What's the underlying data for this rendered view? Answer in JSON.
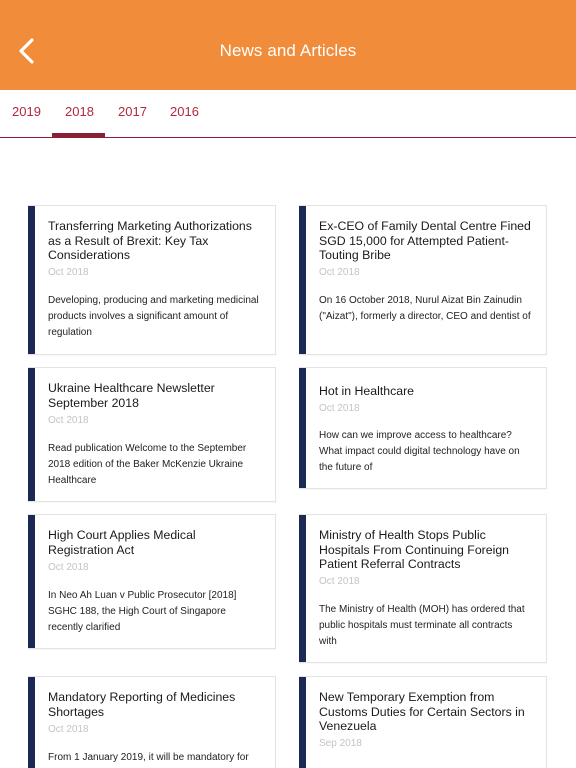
{
  "header": {
    "title": "News and Articles",
    "back_icon": "chevron-left-icon"
  },
  "tabs": [
    {
      "label": "2019"
    },
    {
      "label": "2018",
      "active": true
    },
    {
      "label": "2017"
    },
    {
      "label": "2016"
    }
  ],
  "colors": {
    "header_bg": "#f08c3a",
    "tab_text": "#b3283e",
    "tab_active": "#8a2036",
    "card_accent": "#1b2a55"
  },
  "articles": [
    {
      "title": "Transferring Marketing Authorizations as a Result of Brexit: Key Tax Considerations",
      "date": "Oct 2018",
      "excerpt": "Developing, producing and marketing medicinal products involves a significant amount of regulation"
    },
    {
      "title": "Ex-CEO of Family Dental Centre Fined SGD 15,000 for Attempted Patient-Touting Bribe",
      "date": "Oct 2018",
      "excerpt": "On 16 October 2018, Nurul Aizat Bin Zainudin (\"Aizat\"), formerly a director, CEO and dentist of"
    },
    {
      "title": "Ukraine Healthcare Newsletter September 2018",
      "date": "Oct 2018",
      "excerpt": "Read publication Welcome to the September 2018 edition of the Baker McKenzie Ukraine Healthcare"
    },
    {
      "title": "Hot in Healthcare",
      "date": "Oct 2018",
      "excerpt": "How can we improve access to healthcare? What impact could digital technology have on the future of"
    },
    {
      "title": "High Court Applies Medical Registration Act",
      "date": "Oct 2018",
      "excerpt": "In Neo Ah Luan v Public Prosecutor [2018] SGHC 188, the High Court of Singapore recently clarified"
    },
    {
      "title": "Ministry of Health Stops Public Hospitals From Continuing Foreign Patient Referral Contracts",
      "date": "Oct 2018",
      "excerpt": "The Ministry of Health (MOH) has ordered that public hospitals must terminate all contracts with"
    },
    {
      "title": "Mandatory Reporting of Medicines Shortages",
      "date": "Oct 2018",
      "excerpt": "From 1 January 2019, it will be mandatory for"
    },
    {
      "title": "New Temporary Exemption from Customs Duties for Certain Sectors in Venezuela",
      "date": "Sep 2018",
      "excerpt": ""
    }
  ]
}
